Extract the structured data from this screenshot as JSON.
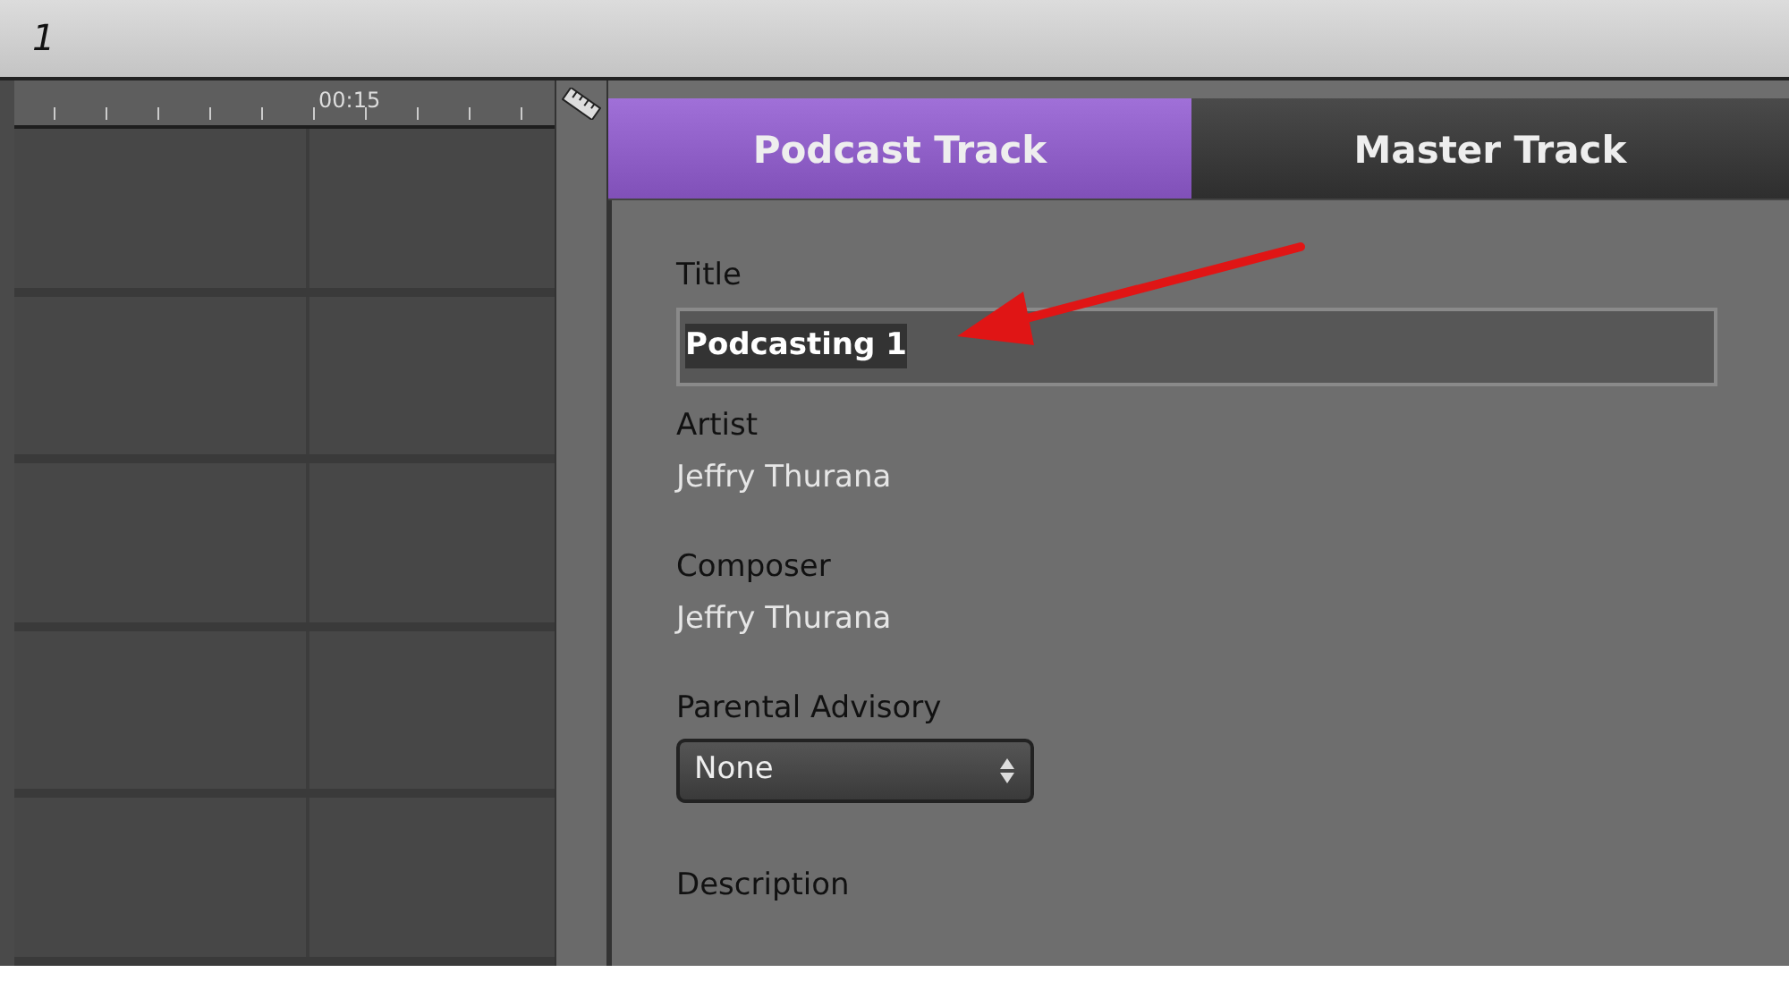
{
  "timeline": {
    "track_label": "1",
    "ruler_time": "00:15"
  },
  "tabs": [
    {
      "label": "Podcast Track",
      "selected": true
    },
    {
      "label": "Master Track",
      "selected": false
    }
  ],
  "fields": [
    {
      "kind": "input",
      "label": "Title",
      "value": "Podcasting 1"
    },
    {
      "kind": "text",
      "label": "Artist",
      "value": "Jeffry Thurana"
    },
    {
      "kind": "text",
      "label": "Composer",
      "value": "Jeffry Thurana"
    },
    {
      "kind": "select",
      "label": "Parental Advisory",
      "value": "None"
    },
    {
      "kind": "label",
      "label": "Description"
    }
  ]
}
